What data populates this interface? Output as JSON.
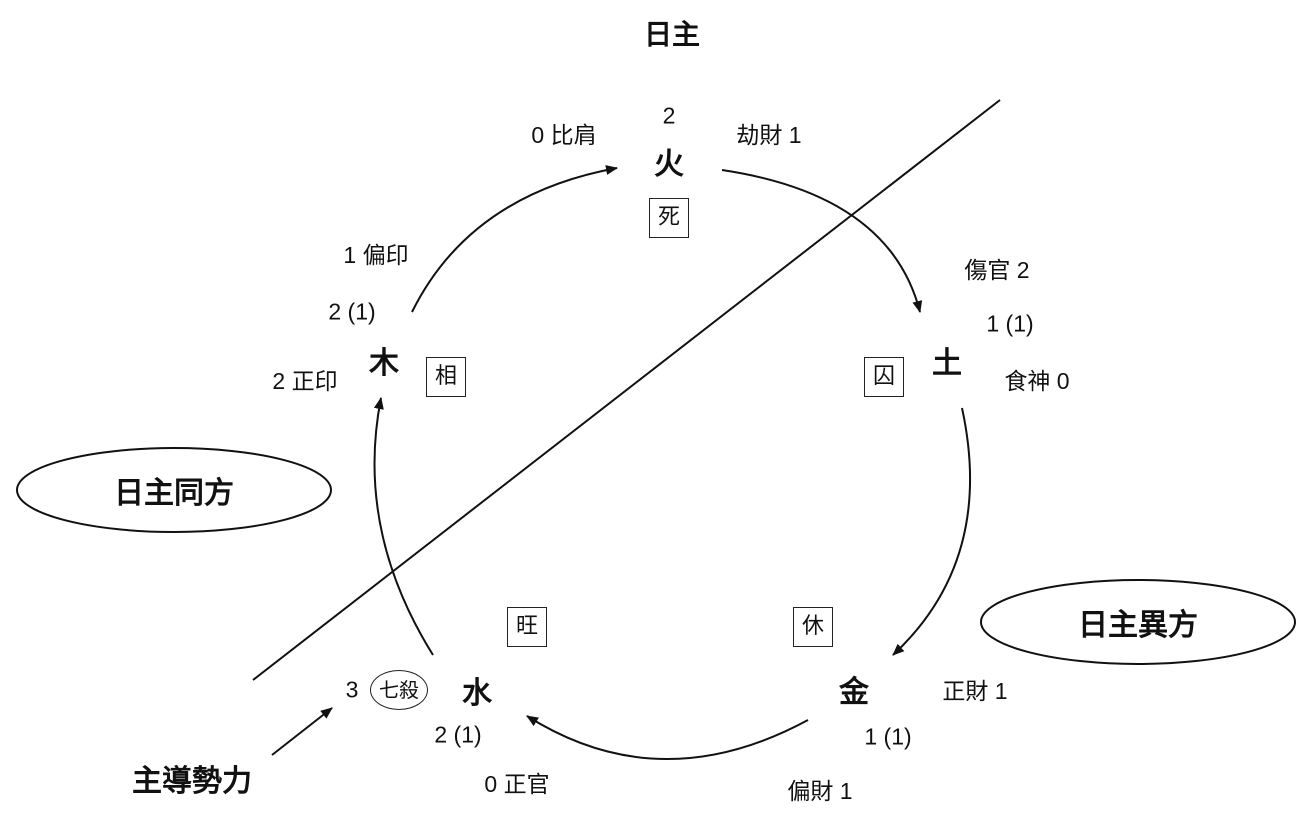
{
  "title": "日主",
  "elements": {
    "fire": {
      "name": "火",
      "count": "2",
      "state": "死"
    },
    "earth": {
      "name": "土",
      "count": "1 (1)",
      "state": "囚"
    },
    "metal": {
      "name": "金",
      "count": "1 (1)",
      "state": "休"
    },
    "water": {
      "name": "水",
      "count": "2 (1)",
      "state": "旺"
    },
    "wood": {
      "name": "木",
      "count": "2 (1)",
      "state": "相"
    }
  },
  "gods": {
    "bijian": "0 比肩",
    "jiecai": "劫財 1",
    "shangguan": "傷官 2",
    "shishen": "食神 0",
    "zhengcai": "正財 1",
    "piancai": "偏財 1",
    "zhengguan": "0 正官",
    "qisha_count": "3",
    "qisha": "七殺",
    "pianyin": "1 偏印",
    "zhengyin": "2 正印"
  },
  "regions": {
    "same_side": "日主同方",
    "different_side": "日主異方",
    "dominant_force": "主導勢力"
  }
}
